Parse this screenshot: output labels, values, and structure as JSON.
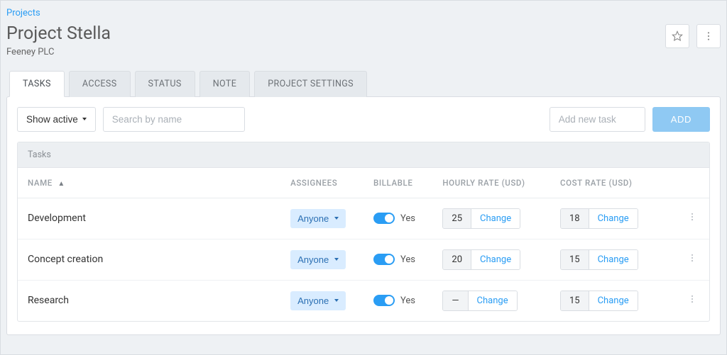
{
  "breadcrumb": {
    "label": "Projects"
  },
  "header": {
    "title": "Project Stella",
    "subtitle": "Feeney PLC"
  },
  "tabs": [
    {
      "label": "TASKS",
      "active": true
    },
    {
      "label": "ACCESS",
      "active": false
    },
    {
      "label": "STATUS",
      "active": false
    },
    {
      "label": "NOTE",
      "active": false
    },
    {
      "label": "PROJECT SETTINGS",
      "active": false
    }
  ],
  "toolbar": {
    "filter_label": "Show active",
    "search_placeholder": "Search by name",
    "add_placeholder": "Add new task",
    "add_button": "ADD"
  },
  "table": {
    "title": "Tasks",
    "columns": {
      "name": "NAME",
      "assignees": "ASSIGNEES",
      "billable": "BILLABLE",
      "hourly_rate": "HOURLY RATE (USD)",
      "cost_rate": "COST RATE (USD)"
    },
    "assignee_label": "Anyone",
    "billable_label": "Yes",
    "change_label": "Change",
    "rows": [
      {
        "name": "Development",
        "billable": true,
        "hourly_rate": "25",
        "cost_rate": "18"
      },
      {
        "name": "Concept creation",
        "billable": true,
        "hourly_rate": "20",
        "cost_rate": "15"
      },
      {
        "name": "Research",
        "billable": true,
        "hourly_rate": "—",
        "cost_rate": "15"
      }
    ]
  }
}
